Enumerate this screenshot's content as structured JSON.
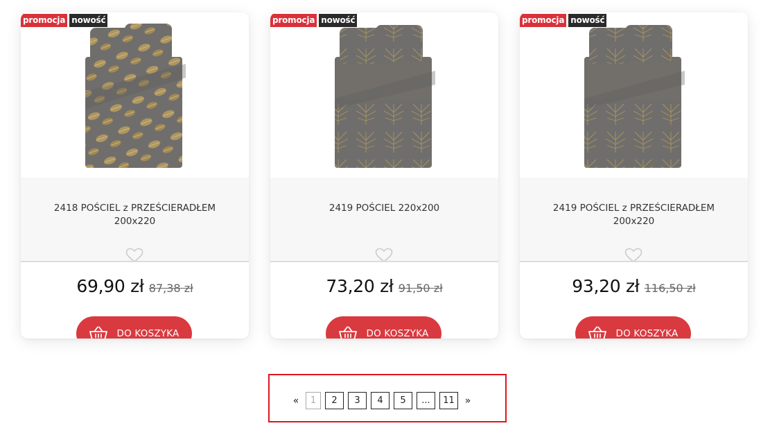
{
  "products": [
    {
      "badges": {
        "promo": "promocja",
        "new": "nowość"
      },
      "title": "2418 POŚCIEL z PRZEŚCIERADŁEM 200x220",
      "price": "69,90 zł",
      "old_price": "87,38 zł",
      "button_label": "DO KOSZYKA",
      "pattern": "leaves"
    },
    {
      "badges": {
        "promo": "promocja",
        "new": "nowość"
      },
      "title": "2419 POŚCIEL 220x200",
      "price": "73,20 zł",
      "old_price": "91,50 zł",
      "button_label": "DO KOSZYKA",
      "pattern": "palm"
    },
    {
      "badges": {
        "promo": "promocja",
        "new": "nowość"
      },
      "title": "2419 POŚCIEL z PRZEŚCIERADŁEM 200x220",
      "price": "93,20 zł",
      "old_price": "116,50 zł",
      "button_label": "DO KOSZYKA",
      "pattern": "palm"
    }
  ],
  "pagination": {
    "prev": "«",
    "next": "»",
    "pages": [
      "1",
      "2",
      "3",
      "4",
      "5",
      "...",
      "11"
    ],
    "current": "1"
  },
  "colors": {
    "accent_red": "#d93a40",
    "badge_promo": "#d9313a",
    "badge_new": "#2a2a2a",
    "bedding_grey": "#6f6e6c",
    "pattern_gold": "#b59a5e"
  },
  "icons": {
    "favorite": "heart-icon",
    "cart": "basket-icon"
  }
}
